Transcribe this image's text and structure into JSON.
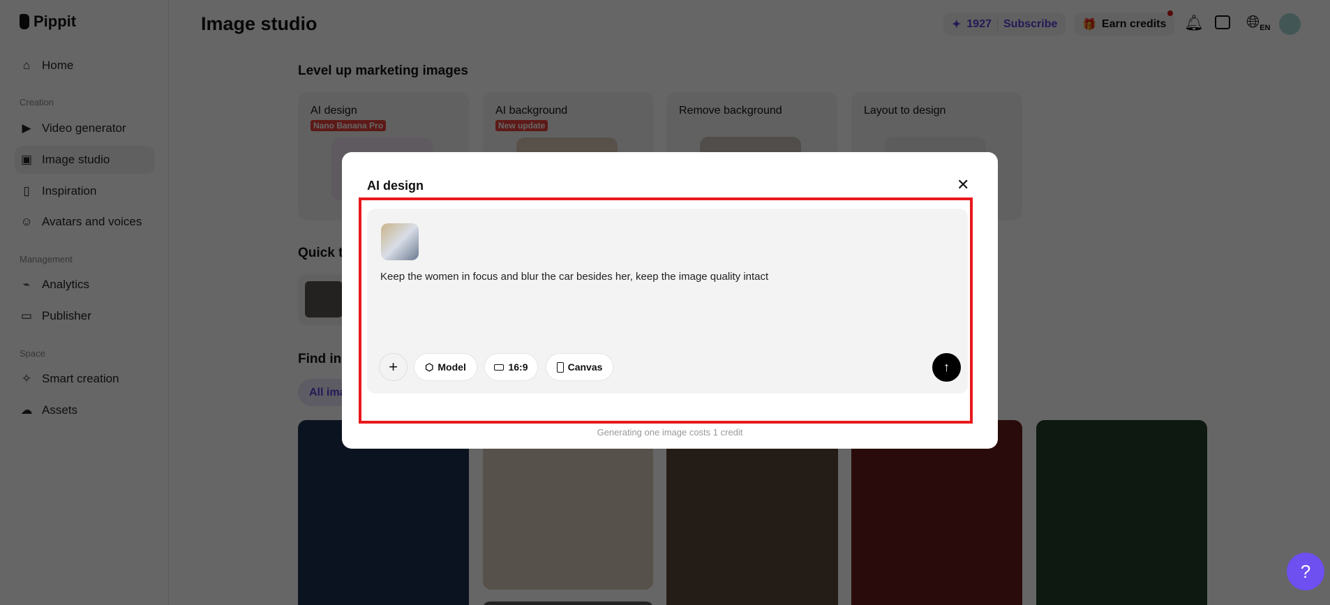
{
  "app": {
    "name": "Pippit",
    "page_title": "Image studio"
  },
  "sidebar": {
    "home": "Home",
    "sections": {
      "creation": "Creation",
      "management": "Management",
      "space": "Space"
    },
    "items": [
      "Video generator",
      "Image studio",
      "Inspiration",
      "Avatars and voices",
      "Analytics",
      "Publisher",
      "Smart creation",
      "Assets"
    ]
  },
  "header": {
    "credits": "1927",
    "subscribe": "Subscribe",
    "earn_credits": "Earn credits",
    "language": "EN"
  },
  "main": {
    "level_up_title": "Level up marketing images",
    "cards": [
      {
        "title": "AI design",
        "badge": "Nano Banana Pro"
      },
      {
        "title": "AI background",
        "badge": "New update"
      },
      {
        "title": "Remove background"
      },
      {
        "title": "Layout to design"
      }
    ],
    "quick_tools_title": "Quick t",
    "find_inspiration_title": "Find ins",
    "filter_all": "All ima"
  },
  "modal": {
    "title": "AI design",
    "prompt": "Keep the women in focus and blur the car besides her, keep the image quality intact",
    "buttons": {
      "model": "Model",
      "ratio": "16:9",
      "canvas": "Canvas"
    },
    "footer": "Generating one image costs 1 credit"
  },
  "colors": {
    "accent": "#5b3fd6",
    "highlight": "#e8191c",
    "help": "#6e4ff0"
  }
}
